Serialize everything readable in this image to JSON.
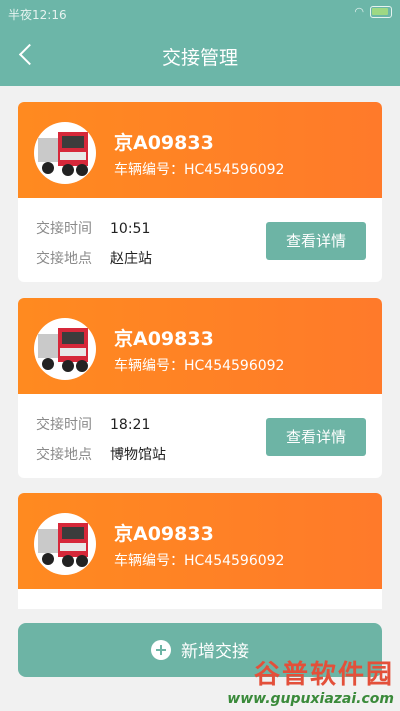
{
  "status_bar": {
    "time": "半夜12:16",
    "wifi_icon": "wifi-icon",
    "battery_icon": "battery-icon"
  },
  "header": {
    "title": "交接管理",
    "back_icon": "back-arrow-icon"
  },
  "cards": [
    {
      "plate": "京A09833",
      "vin_label": "车辆编号：",
      "vin": "HC454596092",
      "time_label": "交接时间",
      "time": "10:51",
      "location_label": "交接地点",
      "location": "赵庄站",
      "detail_label": "查看详情"
    },
    {
      "plate": "京A09833",
      "vin_label": "车辆编号：",
      "vin": "HC454596092",
      "time_label": "交接时间",
      "time": "18:21",
      "location_label": "交接地点",
      "location": "博物馆站",
      "detail_label": "查看详情"
    },
    {
      "plate": "京A09833",
      "vin_label": "车辆编号：",
      "vin": "HC454596092"
    }
  ],
  "add_button": {
    "label": "新增交接",
    "icon": "plus-icon"
  },
  "watermark": {
    "title": "谷普软件园",
    "url": "www.gupuxiazai.com"
  },
  "colors": {
    "primary": "#6cb6a8",
    "card_header": "#ff8a20"
  }
}
